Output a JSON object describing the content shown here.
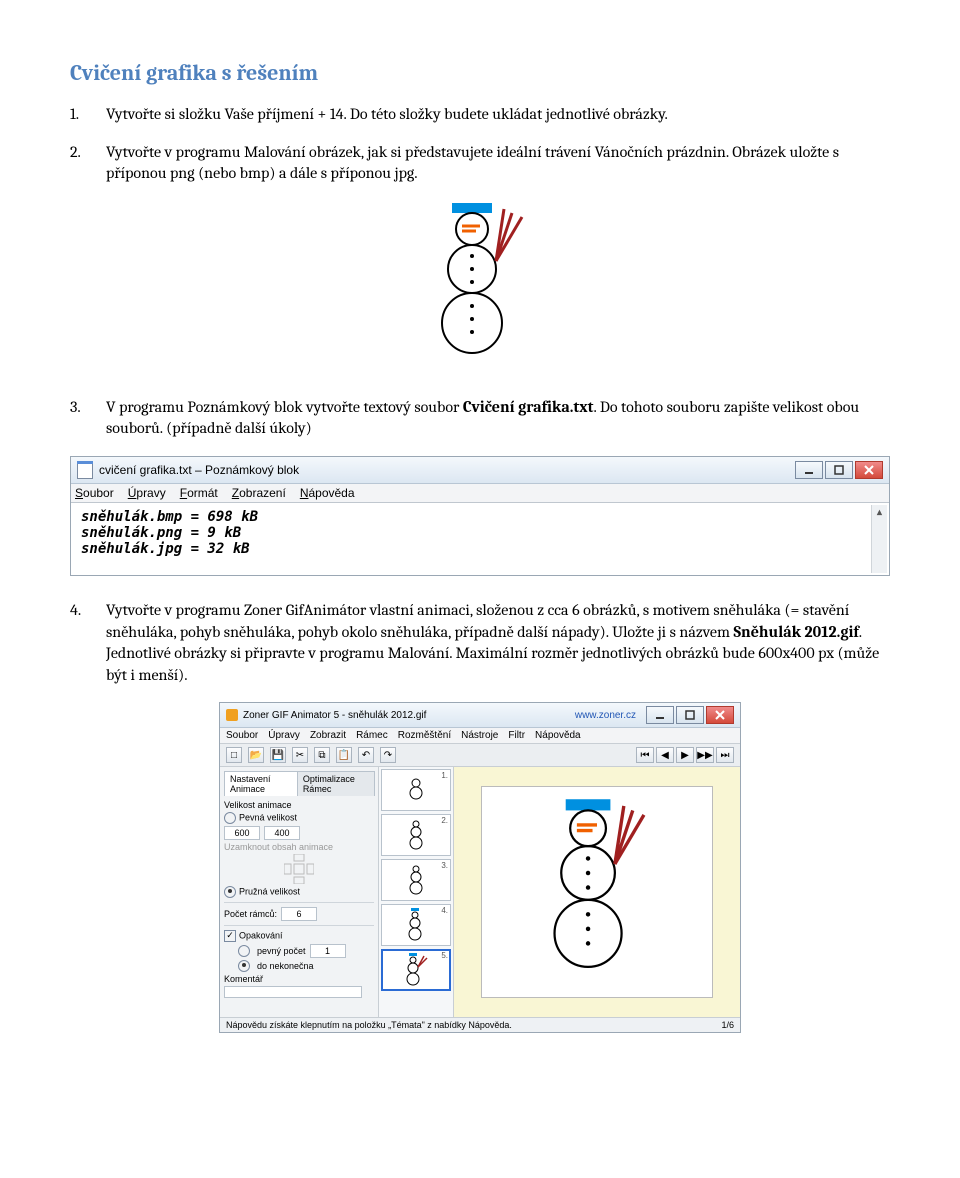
{
  "title": "Cvičení grafika s řešením",
  "items": {
    "1": {
      "num": "1.",
      "text": "Vytvořte si složku Vaše příjmení + 14. Do této složky budete ukládat jednotlivé obrázky."
    },
    "2": {
      "num": "2.",
      "text": "Vytvořte v programu Malování obrázek, jak si představujete ideální trávení Vánočních prázdnin. Obrázek uložte s příponou png (nebo bmp) a dále s příponou jpg."
    },
    "3": {
      "num": "3.",
      "pre": "V programu Poznámkový blok vytvořte textový soubor ",
      "bold": "Cvičení grafika.txt",
      "post": ". Do tohoto souboru zapište velikost obou souborů. (případně další úkoly)"
    },
    "4": {
      "num": "4.",
      "pre": "Vytvořte v programu Zoner GifAnimátor vlastní animaci, složenou z cca 6 obrázků, s motivem sněhuláka (= stavění sněhuláka, pohyb sněhuláka, pohyb okolo sněhuláka, případně další nápady). Uložte ji s názvem ",
      "bold": "Sněhulák 2012.gif",
      "post": ". Jednotlivé obrázky si připravte v programu Malování. Maximální rozměr jednotlivých obrázků bude 600x400 px (může být i menší)."
    }
  },
  "notepad": {
    "title": "cvičení grafika.txt – Poznámkový blok",
    "menu": [
      "Soubor",
      "Úpravy",
      "Formát",
      "Zobrazení",
      "Nápověda"
    ],
    "lines": [
      "sněhulák.bmp = 698 kB",
      "sněhulák.png = 9 kB",
      "sněhulák.jpg = 32 kB"
    ]
  },
  "zoner": {
    "title": "Zoner GIF Animator 5 - sněhulák 2012.gif",
    "url": "www.zoner.cz",
    "menu": [
      "Soubor",
      "Úpravy",
      "Zobrazit",
      "Rámec",
      "Rozměštění",
      "Nástroje",
      "Filtr",
      "Nápověda"
    ],
    "left": {
      "tabs": [
        "Nastavení Animace",
        "Optimalizace Rámec"
      ],
      "size_label": "Velikost animace",
      "opt_fixed": "Pevná velikost",
      "width": "600",
      "height": "400",
      "opt_flexible": "Pružná velikost",
      "trim_label": "Uzamknout obsah animace",
      "frames_label": "Počet rámců:",
      "frames": "6",
      "loop_label": "Opakování",
      "fixed_times": "pevný počet",
      "fixed_times_val": "1",
      "infinite": "do nekonečna",
      "comment": "Komentář"
    },
    "thumbs": [
      "1.",
      "2.",
      "3.",
      "4.",
      "5."
    ],
    "status_left": "Nápovědu získáte klepnutím na položku „Témata\" z nabídky Nápověda.",
    "status_right": "1/6"
  }
}
